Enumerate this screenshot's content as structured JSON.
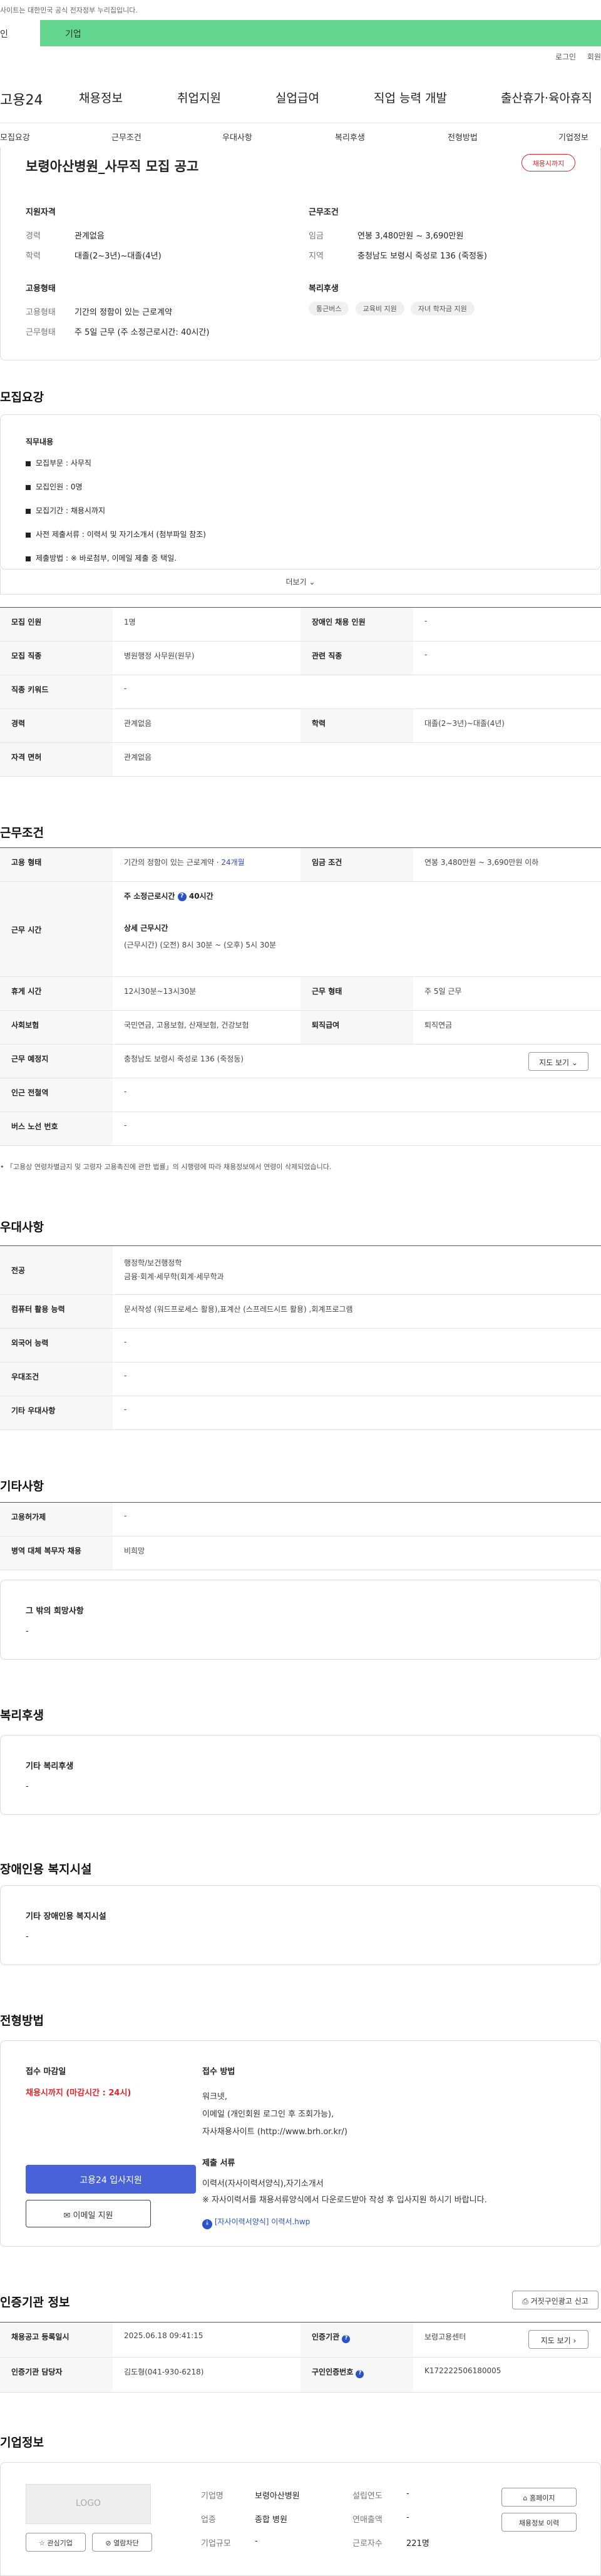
{
  "top_notice": "사이트는 대한민국 공식 전자정부 누리집입니다.",
  "tabs": {
    "personal": "인",
    "business": "기업"
  },
  "util": {
    "login": "로그인",
    "signup": "회원"
  },
  "gnb": {
    "logo": "고용24",
    "items": [
      "채용정보",
      "취업지원",
      "실업급여",
      "직업 능력 개발",
      "출산휴가·육아휴직"
    ]
  },
  "snb": [
    "모집요강",
    "근무조건",
    "우대사항",
    "복리후생",
    "전형방법",
    "기업정보"
  ],
  "job": {
    "title": "보령아산병원_사무직 모집 공고",
    "badge": "채용시까지",
    "qual_title": "지원자격",
    "career_label": "경력",
    "career_value": "관계없음",
    "edu_label": "학력",
    "edu_value": "대졸(2~3년)~대졸(4년)",
    "cond_title": "근무조건",
    "wage_label": "임금",
    "wage_value": "연봉 3,480만원 ~ 3,690만원",
    "region_label": "지역",
    "region_value": "충청남도 보령시 죽성로 136 (죽정동)",
    "emp_title": "고용형태",
    "emp_type_label": "고용형태",
    "emp_type_value": "기간의 정함이 있는 근로계약",
    "work_form_label": "근무형태",
    "work_form_value": "주 5일 근무 (주 소정근로시간: 40시간)",
    "welfare_title": "복리후생",
    "welfare_chips": [
      "통근버스",
      "교육비 지원",
      "자녀 학자금 지원"
    ]
  },
  "recruit": {
    "section_title": "모집요강",
    "duty_title": "직무내용",
    "duties": [
      "모집부문 : 사무직",
      "모집인원 : 0명",
      "모집기간 : 채용시까지",
      "사전 제출서류 : 이력서 및 자기소개서 (첨부파일 참조)",
      "제출방법 : ※ 바로첨부, 이메일 제출 중 택일."
    ],
    "more": "더보기 ⌄",
    "rows": [
      [
        "모집 인원",
        "1명",
        "장애인 채용 인원",
        "-"
      ],
      [
        "모집 직종",
        "병원행정 사무원(원무)",
        "관련 직종",
        "-"
      ],
      [
        "직종 키워드",
        "-",
        "",
        ""
      ],
      [
        "경력",
        "관계없음",
        "학력",
        "대졸(2~3년)~대졸(4년)"
      ],
      [
        "자격 면허",
        "관계없음",
        "",
        ""
      ]
    ]
  },
  "work": {
    "section_title": "근무조건",
    "emp_label": "고용 형태",
    "emp_value": "기간의 정함이 있는 근로계약 · ",
    "emp_months": "24개월",
    "wage_label": "임금 조건",
    "wage_value": "연봉 3,480만원 ~ 3,690만원 이하",
    "hours_label": "근무 시간",
    "hours_main": "주 소정근로시간",
    "hours_main_value": "40시간",
    "hours_detail_title": "상세 근무시간",
    "hours_detail_value": "(근무시간) (오전) 8시 30분 ~ (오후) 5시 30분",
    "break_label": "휴게 시간",
    "break_value": "12시30분~13시30분",
    "form_label": "근무 형태",
    "form_value": "주 5일 근무",
    "ins_label": "사회보험",
    "ins_value": "국민연금, 고용보험, 산재보험, 건강보험",
    "sev_label": "퇴직급여",
    "sev_value": "퇴직연금",
    "place_label": "근무 예정지",
    "place_value": "충청남도 보령시 죽성로 136 (죽정동)",
    "map_btn": "지도 보기 ⌄",
    "station_label": "인근 전철역",
    "station_value": "-",
    "bus_label": "버스 노선 번호",
    "bus_value": "-",
    "note": "「고용상 연령차별금지 및 고령자 고용촉진에 관한 법률」의 시행령에 따라 채용정보에서 연령이 삭제되었습니다."
  },
  "pref": {
    "section_title": "우대사항",
    "rows": [
      [
        "전공",
        "행정학/보건행정학",
        "금융·회계·세무학(회계·세무학과"
      ],
      [
        "컴퓨터 활용 능력",
        "문서작성 (워드프로세스 활용),표계산 (스프레드시트 활용) ,회계프로그램",
        ""
      ],
      [
        "외국어 능력",
        "-",
        ""
      ],
      [
        "우대조건",
        "-",
        ""
      ],
      [
        "기타 우대사항",
        "-",
        ""
      ]
    ]
  },
  "etc": {
    "section_title": "기타사항",
    "rows": [
      [
        "고용허가제",
        "-"
      ],
      [
        "병역 대체 복무자 채용",
        "비희망"
      ]
    ],
    "other_title": "그 밖의 희망사항",
    "other_value": "-"
  },
  "welfare": {
    "section_title": "복리후생",
    "box_title": "기타 복리후생",
    "box_value": "-"
  },
  "disability": {
    "section_title": "장애인용 복지시설",
    "box_title": "기타 장애인용 복지시설",
    "box_value": "-"
  },
  "screening": {
    "section_title": "전형방법",
    "deadline_title": "접수 마감일",
    "deadline_value": "채용시까지 (마감시간 : 24시)",
    "apply_btn": "고용24 입사지원",
    "email_btn": "이메일 지원",
    "method_title": "접수 방법",
    "method_lines": [
      "워크넷,",
      "이메일 (개인회원 로그인 후 조회가능),",
      "자사채용사이트 (http://www.brh.or.kr/)"
    ],
    "docs_title": "제출 서류",
    "docs_lines": [
      "이력서(자사이력서양식),자기소개서",
      "※ 자사이력서를 채용서류양식에서 다운로드받아 작성 후 입사지원 하시기 바랍니다."
    ],
    "file_link": "[자사이력서양식] 이력서.hwp"
  },
  "cert": {
    "section_title": "인증기관 정보",
    "report_btn": "거짓구인광고 신고",
    "reg_label": "채용공고 등록일시",
    "reg_value": "2025.06.18 09:41:15",
    "agency_label": "인증기관",
    "agency_value": "보령고용센터",
    "map_btn": "지도 보기 ›",
    "manager_label": "인증기관 담당자",
    "manager_value": "김도형(041-930-6218)",
    "num_label": "구인인증번호",
    "num_value": "K172222506180005"
  },
  "company": {
    "section_title": "기업정보",
    "logo": "LOGO",
    "fav_btn": "☆ 관심기업",
    "block_btn": "⊘ 열람차단",
    "name_label": "기업명",
    "name_value": "보령아산병원",
    "found_label": "설립연도",
    "found_value": "-",
    "industry_label": "업종",
    "industry_value": "종합 병원",
    "revenue_label": "연매출액",
    "revenue_value": "-",
    "scale_label": "기업규모",
    "scale_value": "-",
    "staff_label": "근로자수",
    "staff_value": "221명",
    "home_btn": "홈페이지",
    "history_btn": "채용정보 이력"
  }
}
